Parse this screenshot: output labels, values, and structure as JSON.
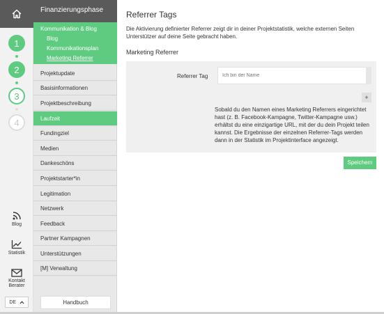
{
  "rail": {
    "home_icon": "home-icon",
    "steps": [
      "1",
      "2",
      "3",
      "4"
    ],
    "blog_label": "Blog",
    "statistik_label": "Statistik",
    "kontakt_label": "Kontakt Berater",
    "language": "DE"
  },
  "nav": {
    "phase_title": "Finanzierungsphase",
    "group_title": "Kommunikation & Blog",
    "group_items": [
      "Blog",
      "Kommunikationsplan",
      "Marketing Referrer"
    ],
    "items": [
      "Projektupdate",
      "Basisinformationen",
      "Projektbeschreibung",
      "Laufzeit",
      "Fundingziel",
      "Medien",
      "Dankeschöns",
      "Projektstarter*in",
      "Legitimation",
      "Netzwerk",
      "Feedback",
      "Partner Kampagnen",
      "Unterstützungen",
      "[M] Verwaltung"
    ],
    "handbuch": "Handbuch"
  },
  "main": {
    "title": "Referrer Tags",
    "intro": "Die Aktivierung definierter Referrer zeigt dir in deiner Projektstatistik, welche externen Seiten Unterstützer auf deine Seite gebracht haben.",
    "section_title": "Marketing Referrer",
    "field_label": "Referrer Tag",
    "input_placeholder": "Ich bin der Name",
    "add_label": "+",
    "help_text": "Sobald du den Namen eines Marketing Referrers eingerichtet hast (z. B. Facebook-Kampagne, Twitter-Kampagne usw.) erhältst du eine einzigartige URL, mit der du dein Projekt teilen kannst. Die Ergebnisse der einzelnen Referrer-Tags werden dann in der Statistik im Projektinterface angezeigt.",
    "save_label": "Speichern"
  },
  "colors": {
    "accent": "#5ecb80",
    "dark": "#5a5a5a"
  }
}
